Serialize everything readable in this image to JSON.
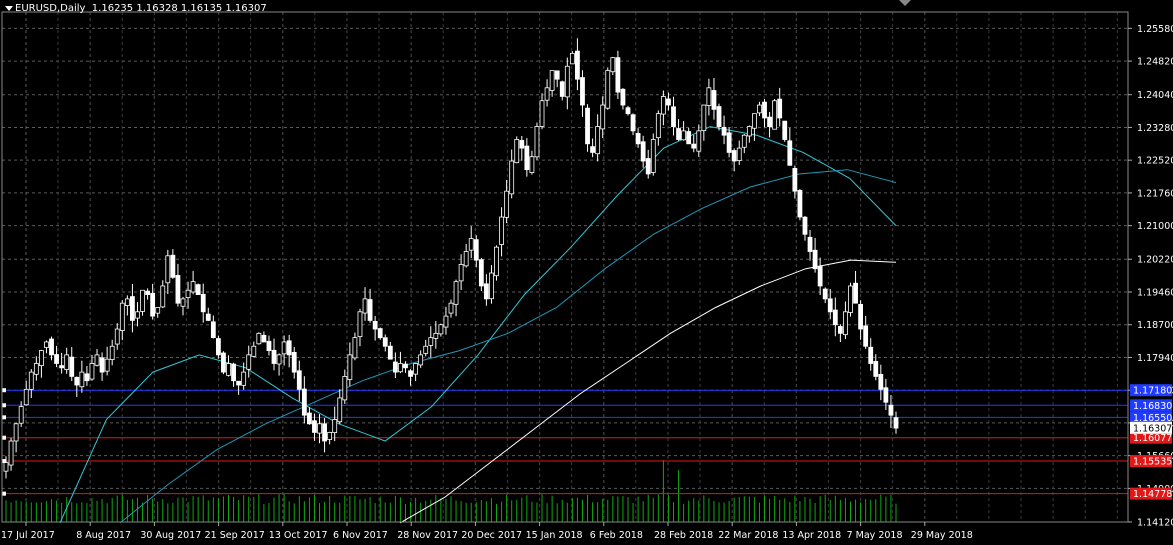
{
  "header": {
    "symbol": "EURUSD,Daily",
    "ohlc": "1.16235 1.16328 1.16135 1.16307"
  },
  "colors": {
    "background": "#000000",
    "grid": "#5a5a5a",
    "candle": "#ffffff",
    "ma_fast": "#30c8d8",
    "ma_mid": "#2098b8",
    "ma_slow": "#ffffff",
    "volume": "#10a810",
    "blue_level": "#1f3bff",
    "red_level": "#e01818",
    "current_price": "#ffffff"
  },
  "price_axis": {
    "labels": [
      "1.25580",
      "1.24820",
      "1.24040",
      "1.23280",
      "1.22520",
      "1.21760",
      "1.21000",
      "1.20220",
      "1.19460",
      "1.18700",
      "1.17940",
      "1.17180",
      "1.16420",
      "1.15660",
      "1.14900",
      "1.14120"
    ]
  },
  "time_axis": {
    "labels": [
      "17 Jul 2017",
      "8 Aug 2017",
      "30 Aug 2017",
      "21 Sep 2017",
      "13 Oct 2017",
      "6 Nov 2017",
      "28 Nov 2017",
      "20 Dec 2017",
      "15 Jan 2018",
      "6 Feb 2018",
      "28 Feb 2018",
      "22 Mar 2018",
      "13 Apr 2018",
      "7 May 2018",
      "29 May 2018"
    ]
  },
  "levels": {
    "blue": [
      {
        "label": "1.17180",
        "price": 1.1718
      },
      {
        "label": "1.16830",
        "price": 1.1683
      },
      {
        "label": "1.16550",
        "price": 1.1655
      }
    ],
    "red": [
      {
        "label": "1.16077",
        "price": 1.16077
      },
      {
        "label": "1.15535",
        "price": 1.15535
      },
      {
        "label": "1.14778",
        "price": 1.14778
      }
    ],
    "current": {
      "label": "1.16307",
      "price": 1.16307
    }
  },
  "chart_data": {
    "type": "candlestick",
    "title": "EURUSD,Daily",
    "ylim": [
      1.1412,
      1.2596
    ],
    "date_range": [
      "17 Jul 2017",
      "29 May 2018"
    ],
    "grid": true,
    "series": [
      {
        "name": "EURUSD close (approx.)",
        "values": [
          1.155,
          1.16,
          1.164,
          1.168,
          1.172,
          1.176,
          1.178,
          1.181,
          1.183,
          1.18,
          1.178,
          1.177,
          1.18,
          1.175,
          1.173,
          1.176,
          1.174,
          1.178,
          1.18,
          1.176,
          1.179,
          1.182,
          1.186,
          1.192,
          1.193,
          1.188,
          1.19,
          1.195,
          1.194,
          1.189,
          1.191,
          1.196,
          1.203,
          1.198,
          1.192,
          1.193,
          1.195,
          1.197,
          1.194,
          1.19,
          1.188,
          1.184,
          1.18,
          1.176,
          1.178,
          1.174,
          1.173,
          1.176,
          1.18,
          1.182,
          1.185,
          1.183,
          1.181,
          1.178,
          1.18,
          1.183,
          1.18,
          1.176,
          1.172,
          1.166,
          1.164,
          1.162,
          1.164,
          1.16,
          1.162,
          1.165,
          1.17,
          1.175,
          1.18,
          1.184,
          1.19,
          1.193,
          1.188,
          1.186,
          1.184,
          1.182,
          1.179,
          1.176,
          1.178,
          1.177,
          1.175,
          1.178,
          1.18,
          1.182,
          1.184,
          1.185,
          1.187,
          1.189,
          1.192,
          1.197,
          1.201,
          1.204,
          1.207,
          1.202,
          1.196,
          1.193,
          1.199,
          1.205,
          1.212,
          1.218,
          1.225,
          1.23,
          1.228,
          1.223,
          1.226,
          1.233,
          1.239,
          1.242,
          1.246,
          1.244,
          1.24,
          1.247,
          1.25,
          1.244,
          1.238,
          1.229,
          1.227,
          1.233,
          1.238,
          1.246,
          1.249,
          1.241,
          1.238,
          1.236,
          1.232,
          1.229,
          1.225,
          1.222,
          1.23,
          1.236,
          1.24,
          1.238,
          1.233,
          1.23,
          1.232,
          1.229,
          1.228,
          1.232,
          1.238,
          1.242,
          1.237,
          1.233,
          1.231,
          1.227,
          1.225,
          1.228,
          1.231,
          1.233,
          1.236,
          1.238,
          1.235,
          1.233,
          1.239,
          1.235,
          1.23,
          1.224,
          1.218,
          1.212,
          1.208,
          1.204,
          1.2,
          1.196,
          1.193,
          1.19,
          1.187,
          1.185,
          1.19,
          1.196,
          1.192,
          1.186,
          1.182,
          1.178,
          1.175,
          1.172,
          1.169,
          1.166,
          1.163
        ]
      },
      {
        "name": "MA fast (approx.)",
        "values": [
          1.141,
          1.165,
          1.176,
          1.18,
          1.177,
          1.17,
          1.164,
          1.16,
          1.168,
          1.18,
          1.194,
          1.205,
          1.217,
          1.228,
          1.233,
          1.231,
          1.227,
          1.221,
          1.21
        ]
      },
      {
        "name": "MA mid (approx.)",
        "values": [
          1.141,
          1.15,
          1.158,
          1.164,
          1.169,
          1.174,
          1.178,
          1.181,
          1.185,
          1.191,
          1.2,
          1.208,
          1.214,
          1.219,
          1.222,
          1.223,
          1.22
        ]
      },
      {
        "name": "MA slow (approx.)",
        "values": [
          1.141,
          1.147,
          1.155,
          1.163,
          1.171,
          1.178,
          1.185,
          1.191,
          1.196,
          1.2,
          1.202,
          1.2015
        ]
      }
    ]
  }
}
